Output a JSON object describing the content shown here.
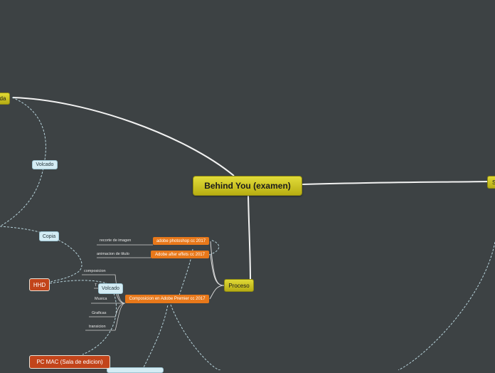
{
  "central": "Behind You (examen)",
  "left_topic": "da",
  "right_topic": "S",
  "proceso": "Proceso",
  "labels": {
    "volcado_top": "Volcado",
    "copia": "Copia",
    "volcado_mid": "Volcado"
  },
  "hhd": "HHD",
  "pc_mac": "PC MAC (Sala de edicion)",
  "tools": {
    "photoshop": "adobe photoshop cc 2017",
    "after_effects": "Adobe after effets cc 2017",
    "premier": "Composicion en Adobe Premier cc 2017"
  },
  "leaves": {
    "recorte": "recorte de imagen",
    "animacion": "animacion de titulo",
    "composicion": "composicion",
    "t": "T",
    "musica": "Musica",
    "graficas": "Graficas",
    "transicion": "transicion"
  },
  "colors": {
    "background": "#3d4244",
    "topic": "#d2c828",
    "tool": "#e8781a",
    "storage": "#c2441a",
    "label": "#d4ecf4"
  }
}
